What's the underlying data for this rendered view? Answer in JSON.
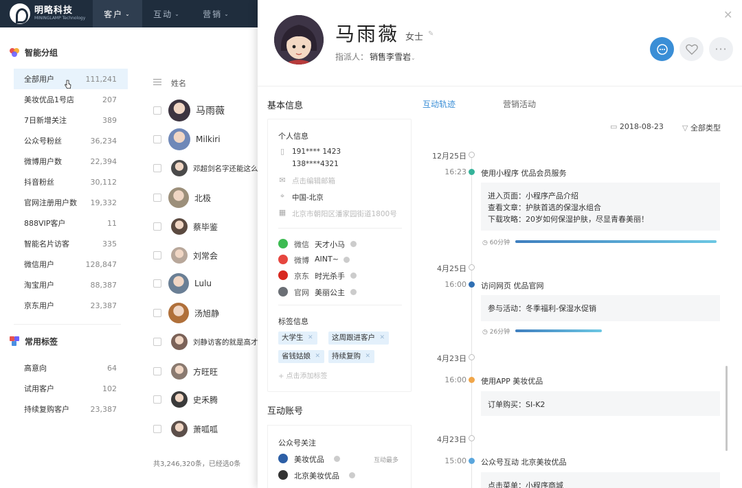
{
  "brand": {
    "name": "明略科技",
    "tagline": "MININGLAMP Technology",
    "trademark": "TM"
  },
  "nav": [
    {
      "label": "客户",
      "active": true
    },
    {
      "label": "互动",
      "active": false
    },
    {
      "label": "营销",
      "active": false
    }
  ],
  "segments": {
    "title": "智能分组",
    "items": [
      {
        "label": "全部用户",
        "count": "111,241"
      },
      {
        "label": "美妆优品1号店",
        "count": "207"
      },
      {
        "label": "7日新增关注",
        "count": "389"
      },
      {
        "label": "公众号粉丝",
        "count": "36,234"
      },
      {
        "label": "微博用户数",
        "count": "22,394"
      },
      {
        "label": "抖音粉丝",
        "count": "30,112"
      },
      {
        "label": "官网注册用户数",
        "count": "19,332"
      },
      {
        "label": "888VIP客户",
        "count": "11"
      },
      {
        "label": "智能名片访客",
        "count": "335"
      },
      {
        "label": "微信用户",
        "count": "128,847"
      },
      {
        "label": "淘宝用户",
        "count": "88,387"
      },
      {
        "label": "京东用户",
        "count": "23,387"
      }
    ]
  },
  "tags": {
    "title": "常用标签",
    "items": [
      {
        "label": "高意向",
        "count": "64"
      },
      {
        "label": "试用客户",
        "count": "102"
      },
      {
        "label": "持续复购客户",
        "count": "23,387"
      }
    ]
  },
  "customer_list": {
    "column_header": "姓名",
    "rows": [
      {
        "name": "马雨薇",
        "avatar_color": "#3c3440"
      },
      {
        "name": "Milkiri",
        "avatar_color": "#6f88b8"
      },
      {
        "name": "邓超剑名字还能这么长",
        "avatar_color": "#4a4a4a"
      },
      {
        "name": "北极",
        "avatar_color": "#9c8f7a"
      },
      {
        "name": "蔡毕鉴",
        "avatar_color": "#5b4a40"
      },
      {
        "name": "刘常会",
        "avatar_color": "#b8a79a"
      },
      {
        "name": "Lulu",
        "avatar_color": "#6a7f95"
      },
      {
        "name": "汤旭静",
        "avatar_color": "#b0703a"
      },
      {
        "name": "刘静访客的就是高才",
        "avatar_color": "#7b6258"
      },
      {
        "name": "方旺旺",
        "avatar_color": "#8a7a70"
      },
      {
        "name": "史禾腾",
        "avatar_color": "#3a3a3a"
      },
      {
        "name": "萧呱呱",
        "avatar_color": "#5c4f4a"
      }
    ],
    "footer": "共3,246,320条，已经选0条"
  },
  "detail": {
    "name": "马雨薇",
    "title": "女士",
    "assignee_label": "指派人：",
    "assignee": "销售李雪岩",
    "basic_info_title": "基本信息",
    "personal_info_title": "个人信息",
    "phones": [
      "191**** 1423",
      "138****4321"
    ],
    "email_placeholder": "点击编辑邮箱",
    "region": "中国-北京",
    "address": "北京市朝阳区潘家园街道1800号",
    "social": [
      {
        "type": "微信",
        "account": "天才小马",
        "color": "#3dbb52"
      },
      {
        "type": "微博",
        "account": "AINT~",
        "color": "#e6463f"
      },
      {
        "type": "京东",
        "account": "时光杀手",
        "color": "#d8281f"
      },
      {
        "type": "官网",
        "account": "美丽公主",
        "color": "#6b6f75"
      }
    ],
    "tag_section_title": "标签信息",
    "tags": [
      "大学生",
      "这周跟进客户",
      "省钱姑娘",
      "持续复购"
    ],
    "add_tag": "+ 点击添加标签",
    "account_section_title": "互动账号",
    "account_card": {
      "title": "公众号关注",
      "rows": [
        {
          "name": "美妆优品",
          "extra": "互动最多",
          "color": "#2d5fa6"
        },
        {
          "name": "北京美妆优品",
          "extra": "",
          "color": "#333"
        }
      ]
    }
  },
  "tabs": [
    {
      "label": "互动轨迹",
      "active": true
    },
    {
      "label": "营销活动",
      "active": false
    }
  ],
  "filters": {
    "date": "2018-08-23",
    "type": "全部类型"
  },
  "timeline": [
    {
      "date": "12月25日",
      "time": "16:23",
      "dot_color": "#35b39a",
      "title": "使用小程序  优品会员服务",
      "details": [
        "进入页面：小程序产品介绍",
        "查看文章：护肤首选的保湿水组合",
        "下载攻略：20岁如何保湿护肤，尽显青春美丽！"
      ],
      "duration": "60分钟",
      "duration_fraction": 1.0
    },
    {
      "date": "4月25日",
      "time": "16:00",
      "dot_color": "#2f6fb3",
      "title": "访问网页 优品官网",
      "details": [
        "参与活动：冬季福利-保湿水促销"
      ],
      "duration": "26分钟",
      "duration_fraction": 0.43
    },
    {
      "date": "4月23日",
      "time": "16:00",
      "dot_color": "#f0a64a",
      "title": "使用APP 美妆优品",
      "details": [
        "订单购买：SI-K2"
      ]
    },
    {
      "date": "4月23日",
      "time": "15:00",
      "dot_color": "#5aa6dd",
      "title": "公众号互动 北京美妆优品",
      "details": [
        "点击菜单：小程序商城"
      ]
    }
  ]
}
